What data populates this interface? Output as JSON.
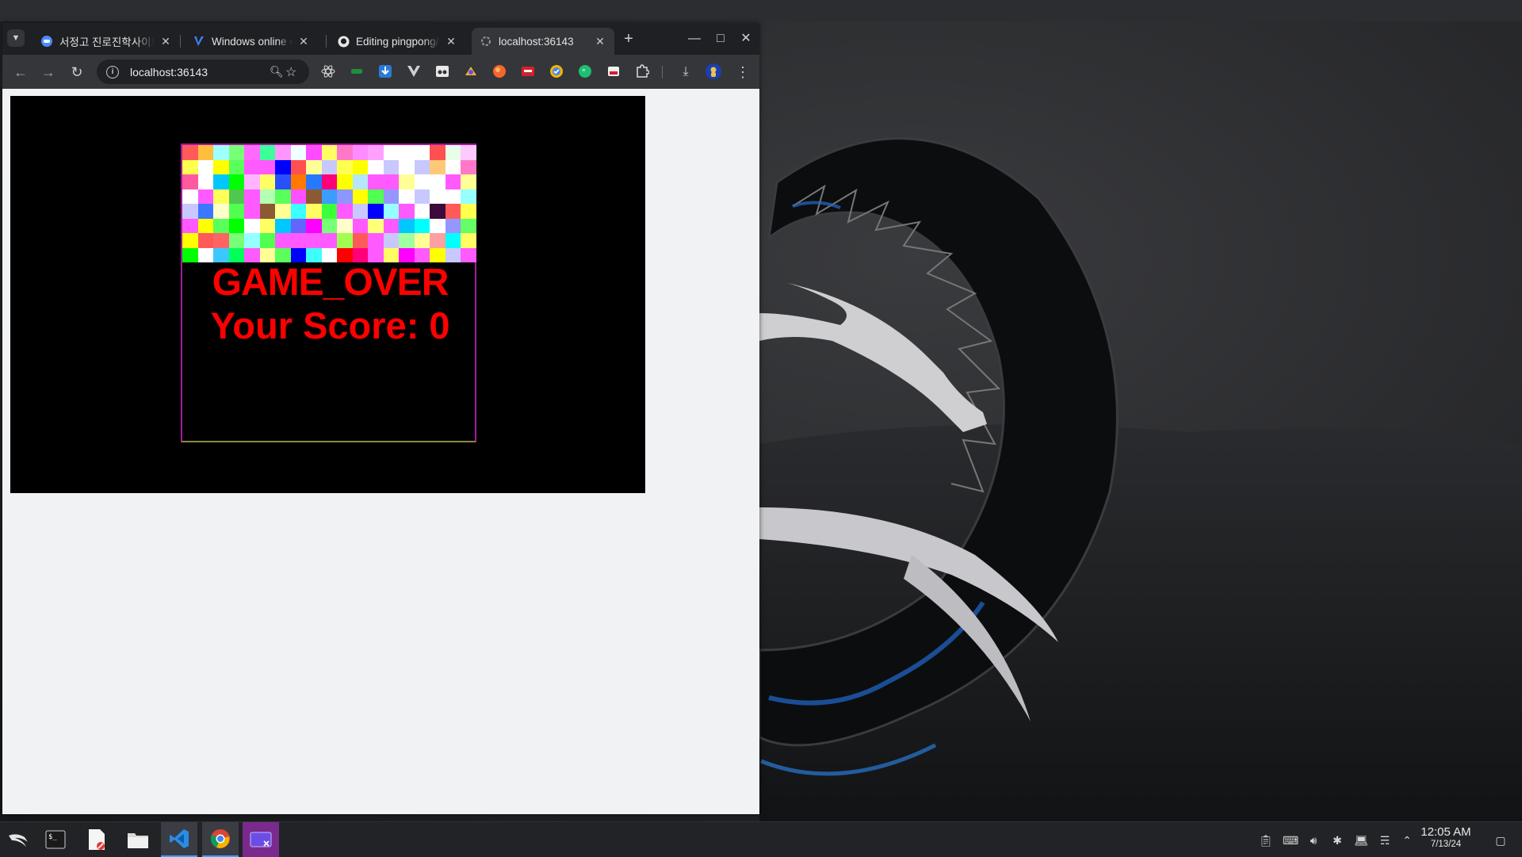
{
  "browser": {
    "tabs": [
      {
        "title": "서정고 진로진학사이트",
        "favicon": "chat-bubble-icon",
        "active": false
      },
      {
        "title": "Windows online editor",
        "favicon": "v-logo-icon",
        "active": false
      },
      {
        "title": "Editing pingpong/",
        "favicon": "github-icon",
        "active": false
      },
      {
        "title": "localhost:36143",
        "favicon": "loading-icon",
        "active": true
      }
    ],
    "new_tab_label": "+",
    "address": "localhost:36143",
    "extensions": [
      "react-icon",
      "green-ext-icon",
      "download-blue-icon",
      "vue-icon",
      "glasses-icon",
      "sparkle-ext-icon",
      "orange-ext-icon",
      "adobe-ext-icon",
      "chrome-check-icon",
      "green-quote-icon",
      "stack-ext-icon",
      "puzzle-icon"
    ],
    "colors": {
      "tab_strip": "#1f2023",
      "toolbar": "#35363a",
      "page_bg": "#f1f2f4"
    }
  },
  "game": {
    "title_text": "GAME_OVER",
    "score_text": "Your Score: 0",
    "text_color": "#ff0000",
    "brick_rows": [
      [
        "#ff5a5a",
        "#ffbe3c",
        "#a0ffff",
        "#78ff78",
        "#ff69ff",
        "#3cff9b",
        "#ff96ff",
        "#f0ffff",
        "#ff4bff",
        "#ffff64",
        "#ff78c8",
        "#ff8cff",
        "#ffa0ff",
        "#ffffff",
        "#ffffff",
        "#ffffff",
        "#ff5050",
        "#e6ffe6",
        "#ffc8ff"
      ],
      [
        "#ffff50",
        "#ffffff",
        "#ffff00",
        "#5aff5a",
        "#ff5aff",
        "#ff5aff",
        "#0000ff",
        "#ff5050",
        "#ffff96",
        "#c8c8ff",
        "#ffff50",
        "#ffff00",
        "#ffffff",
        "#c8c8ff",
        "#ffffff",
        "#c8c8ff",
        "#ffc878",
        "#ffffff",
        "#ff78c8"
      ],
      [
        "#ff5aa0",
        "#ffffff",
        "#00c8ff",
        "#00ff00",
        "#ffb4ff",
        "#ffff64",
        "#2850ff",
        "#ff7800",
        "#2878ff",
        "#ff0078",
        "#ffff00",
        "#b4e6ff",
        "#ff5aff",
        "#ff5aff",
        "#ffff96",
        "#ffffff",
        "#ffffff",
        "#ff5aff",
        "#ffff96"
      ],
      [
        "#ffffff",
        "#ff5aff",
        "#ffff5a",
        "#50c850",
        "#ff5aff",
        "#b4ffb4",
        "#5aff5a",
        "#ff50ff",
        "#8c5a32",
        "#3c9cff",
        "#8c96ff",
        "#ffff00",
        "#50ff50",
        "#9696ff",
        "#ffffff",
        "#c8c8ff",
        "#ffffff",
        "#ffffff",
        "#96ffff"
      ],
      [
        "#c8c8ff",
        "#3c78ff",
        "#ffffc8",
        "#50ff50",
        "#ff5aff",
        "#8c5a32",
        "#ffff96",
        "#3cffff",
        "#ffff64",
        "#3cff3c",
        "#ff5aff",
        "#c8c8ff",
        "#0000ff",
        "#96ffff",
        "#ff5aff",
        "#ffffff",
        "#3c0a3c",
        "#ff5a5a",
        "#ffff50"
      ],
      [
        "#ff5aff",
        "#ffff00",
        "#5aff5a",
        "#00ff00",
        "#ffffff",
        "#ffff64",
        "#00c8ff",
        "#6464ff",
        "#ff00ff",
        "#78ff78",
        "#ffffc8",
        "#ff5aff",
        "#ffff78",
        "#ff5aff",
        "#00c8ff",
        "#00ffff",
        "#ffffff",
        "#9696ff",
        "#64ff64"
      ],
      [
        "#ffff00",
        "#ff5a5a",
        "#ff6464",
        "#78ff78",
        "#96ffff",
        "#50ff50",
        "#ff5aff",
        "#ff5aff",
        "#ff5aff",
        "#ff5aff",
        "#a0ff50",
        "#ff5a5a",
        "#ff5aff",
        "#c8c8ff",
        "#a0ffa0",
        "#ffff96",
        "#ffa0a0",
        "#00ffff",
        "#ffff64"
      ],
      [
        "#00ff00",
        "#ffffff",
        "#3cc8ff",
        "#00ff5a",
        "#ff5aff",
        "#ffff96",
        "#5aff5a",
        "#0000ff",
        "#3cffff",
        "#ffffff",
        "#ff0000",
        "#ff0078",
        "#ff5aff",
        "#ffff64",
        "#ff00ff",
        "#ff5aff",
        "#ffff00",
        "#c8c8ff",
        "#ff5aff"
      ]
    ]
  },
  "taskbar": {
    "apps": [
      "kali-menu-icon",
      "terminal-icon",
      "text-editor-icon",
      "file-manager-icon",
      "vscode-icon",
      "chrome-icon",
      "screenshot-tool-icon"
    ],
    "tray": [
      "clipboard-icon",
      "keyboard-icon",
      "volume-icon",
      "bluetooth-icon",
      "display-icon",
      "wifi-icon",
      "chevron-up-icon",
      "show-desktop-icon"
    ],
    "time": "12:05 AM",
    "date": "7/13/24"
  }
}
